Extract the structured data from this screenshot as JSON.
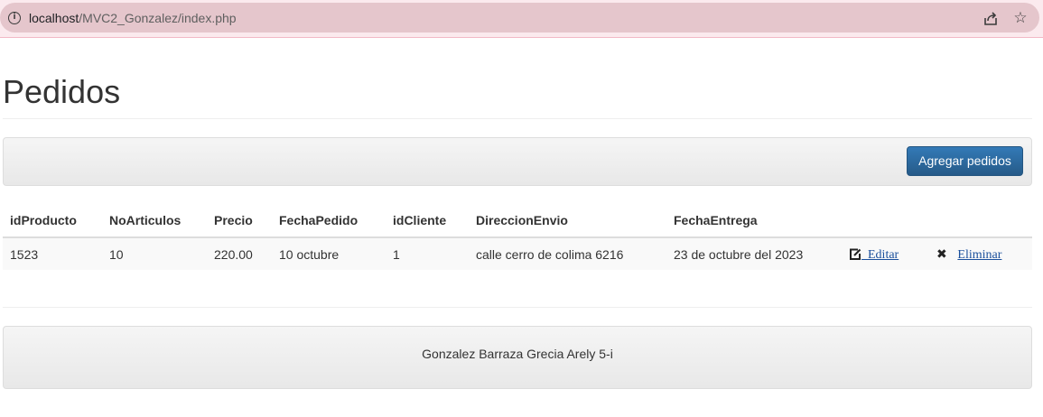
{
  "browser": {
    "url_host": "localhost",
    "url_path": "/MVC2_Gonzalez/index.php"
  },
  "page": {
    "title": "Pedidos"
  },
  "toolbar": {
    "add_label": "Agregar pedidos"
  },
  "table": {
    "headers": [
      "idProducto",
      "NoArticulos",
      "Precio",
      "FechaPedido",
      "idCliente",
      "DireccionEnvio",
      "FechaEntrega"
    ],
    "rows": [
      {
        "cells": [
          "1523",
          "10",
          "220.00",
          "10 octubre",
          "1",
          "calle cerro de colima 6216",
          "23 de octubre del 2023"
        ],
        "edit_label": "Editar",
        "delete_label": "Eliminar"
      }
    ]
  },
  "footer": {
    "text": "Gonzalez Barraza Grecia Arely 5-i"
  },
  "colors": {
    "primary_button": "#337ab7",
    "link": "#1a4f9c",
    "address_bar": "#e5c6cc"
  }
}
